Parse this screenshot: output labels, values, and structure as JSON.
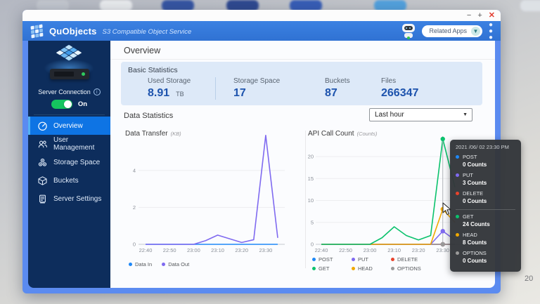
{
  "desktop": {
    "corner_text": "20"
  },
  "window": {
    "titlebar": {
      "minimize": "−",
      "maximize": "+",
      "close": "✕"
    },
    "header": {
      "app_name": "QuObjects",
      "subtitle": "S3 Compatible Object Service",
      "related_apps_label": "Related Apps",
      "related_apps_chevron": "▼"
    }
  },
  "sidebar": {
    "server_connection_label": "Server Connection",
    "info_glyph": "i",
    "toggle_state": "On",
    "items": [
      {
        "label": "Overview",
        "active": true
      },
      {
        "label": "User Management",
        "active": false
      },
      {
        "label": "Storage Space",
        "active": false
      },
      {
        "label": "Buckets",
        "active": false
      },
      {
        "label": "Server Settings",
        "active": false
      }
    ]
  },
  "overview": {
    "page_title": "Overview",
    "basic_statistics": {
      "title": "Basic Statistics",
      "stats": [
        {
          "label": "Used Storage",
          "value": "8.91",
          "unit": "TB"
        },
        {
          "label": "Storage Space",
          "value": "17",
          "unit": ""
        },
        {
          "label": "Buckets",
          "value": "87",
          "unit": ""
        },
        {
          "label": "Files",
          "value": "266347",
          "unit": ""
        }
      ]
    },
    "data_statistics": {
      "title": "Data Statistics",
      "range_selected": "Last hour"
    }
  },
  "chart_data": [
    {
      "type": "line",
      "title": "Data Transfer",
      "unit_label": "(KB)",
      "x": [
        "22:40",
        "22:45",
        "22:50",
        "22:55",
        "23:00",
        "23:05",
        "23:10",
        "23:15",
        "23:20",
        "23:25",
        "23:30",
        "23:35"
      ],
      "x_tick_every": 2,
      "yticks": [
        0,
        2,
        4
      ],
      "ylim": [
        0,
        6
      ],
      "grid": "horizontal",
      "legend_position": "bottom",
      "series": [
        {
          "name": "Data In",
          "color": "#1e88f7",
          "values": [
            0,
            0,
            0,
            0,
            0,
            0,
            0,
            0,
            0,
            0,
            0,
            0
          ]
        },
        {
          "name": "Data Out",
          "color": "#7f6af0",
          "values": [
            0,
            0,
            0,
            0,
            0,
            0.2,
            0.5,
            0.3,
            0.1,
            0.25,
            5.9,
            0.35
          ]
        }
      ]
    },
    {
      "type": "line",
      "title": "API Call Count",
      "unit_label": "(Counts)",
      "x": [
        "22:40",
        "22:45",
        "22:50",
        "22:55",
        "23:00",
        "23:05",
        "23:10",
        "23:15",
        "23:20",
        "23:25",
        "23:30",
        "23:35"
      ],
      "x_tick_every": 2,
      "yticks": [
        0,
        5,
        10,
        15,
        20
      ],
      "ylim": [
        0,
        25
      ],
      "grid": "horizontal",
      "legend_position": "bottom",
      "hover": {
        "x_index": 10
      },
      "series": [
        {
          "name": "POST",
          "color": "#1e88f7",
          "values": [
            0,
            0,
            0,
            0,
            0,
            0,
            0,
            0,
            0,
            0,
            0,
            0
          ]
        },
        {
          "name": "PUT",
          "color": "#7f6af0",
          "values": [
            0,
            0,
            0,
            0,
            0,
            0,
            0,
            0,
            0,
            0,
            3,
            1
          ]
        },
        {
          "name": "DELETE",
          "color": "#e8432c",
          "values": [
            0,
            0,
            0,
            0,
            0,
            0,
            0,
            0,
            0,
            0,
            0,
            0
          ]
        },
        {
          "name": "GET",
          "color": "#0bc26d",
          "values": [
            0,
            0,
            0,
            0,
            0,
            1.5,
            4,
            2,
            1,
            2,
            24,
            13
          ]
        },
        {
          "name": "HEAD",
          "color": "#f0a800",
          "values": [
            0,
            0,
            0,
            0,
            0,
            0,
            0,
            0,
            0,
            0,
            8,
            5
          ]
        },
        {
          "name": "OPTIONS",
          "color": "#9a9a9a",
          "values": [
            0,
            0,
            0,
            0,
            0,
            0,
            0,
            0,
            0,
            0,
            0,
            0
          ]
        }
      ]
    }
  ],
  "tooltip": {
    "title": "2021 /06/ 02 23:30 PM",
    "entries": [
      {
        "name": "POST",
        "value": "0 Counts",
        "color": "#1e88f7"
      },
      {
        "name": "PUT",
        "value": "3 Counts",
        "color": "#7f6af0"
      },
      {
        "name": "DELETE",
        "value": "0 Counts",
        "color": "#e8432c"
      },
      {
        "name": "GET",
        "value": "24 Counts",
        "color": "#0bc26d"
      },
      {
        "name": "HEAD",
        "value": "8 Counts",
        "color": "#f0a800"
      },
      {
        "name": "OPTIONS",
        "value": "0 Counts",
        "color": "#9a9a9a"
      }
    ]
  }
}
